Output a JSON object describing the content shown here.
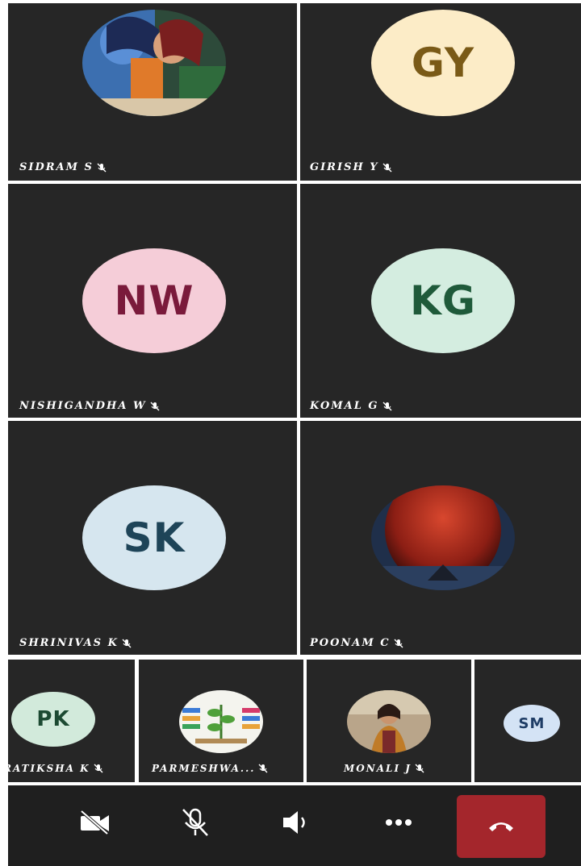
{
  "participants": [
    {
      "name": "SIDRAM S",
      "avatar_type": "photo",
      "photo_desc": "krishna-art"
    },
    {
      "name": "GIRISH Y",
      "initials": "GY",
      "bg": "#fcecc7",
      "fg": "#7a5a17"
    },
    {
      "name": "NISHIGANDHA W",
      "initials": "NW",
      "bg": "#f5cdd8",
      "fg": "#7a1a3b"
    },
    {
      "name": "KOMAL G",
      "initials": "KG",
      "bg": "#d4ede0",
      "fg": "#1f5a3a"
    },
    {
      "name": "SHRINIVAS K",
      "initials": "SK",
      "bg": "#d6e6ef",
      "fg": "#1e4458"
    },
    {
      "name": "POONAM C",
      "avatar_type": "photo",
      "photo_desc": "red-moon"
    }
  ],
  "strip": [
    {
      "name": "RATIKSHA K",
      "initials": "PK",
      "bg": "#d2eadb",
      "fg": "#1c4a32"
    },
    {
      "name": "PARMESHWA...",
      "avatar_type": "photo",
      "photo_desc": "plant-diagram"
    },
    {
      "name": "MONALI J",
      "avatar_type": "photo",
      "photo_desc": "person"
    },
    {
      "initials": "SM",
      "bg": "#d4e3f5",
      "fg": "#1f3d66"
    }
  ],
  "controls": {
    "camera_icon": "camera-off-icon",
    "mic_icon": "mic-off-icon",
    "speaker_icon": "speaker-icon",
    "more_icon": "more-icon",
    "end_icon": "end-call-icon",
    "end_color": "#a4262c"
  }
}
